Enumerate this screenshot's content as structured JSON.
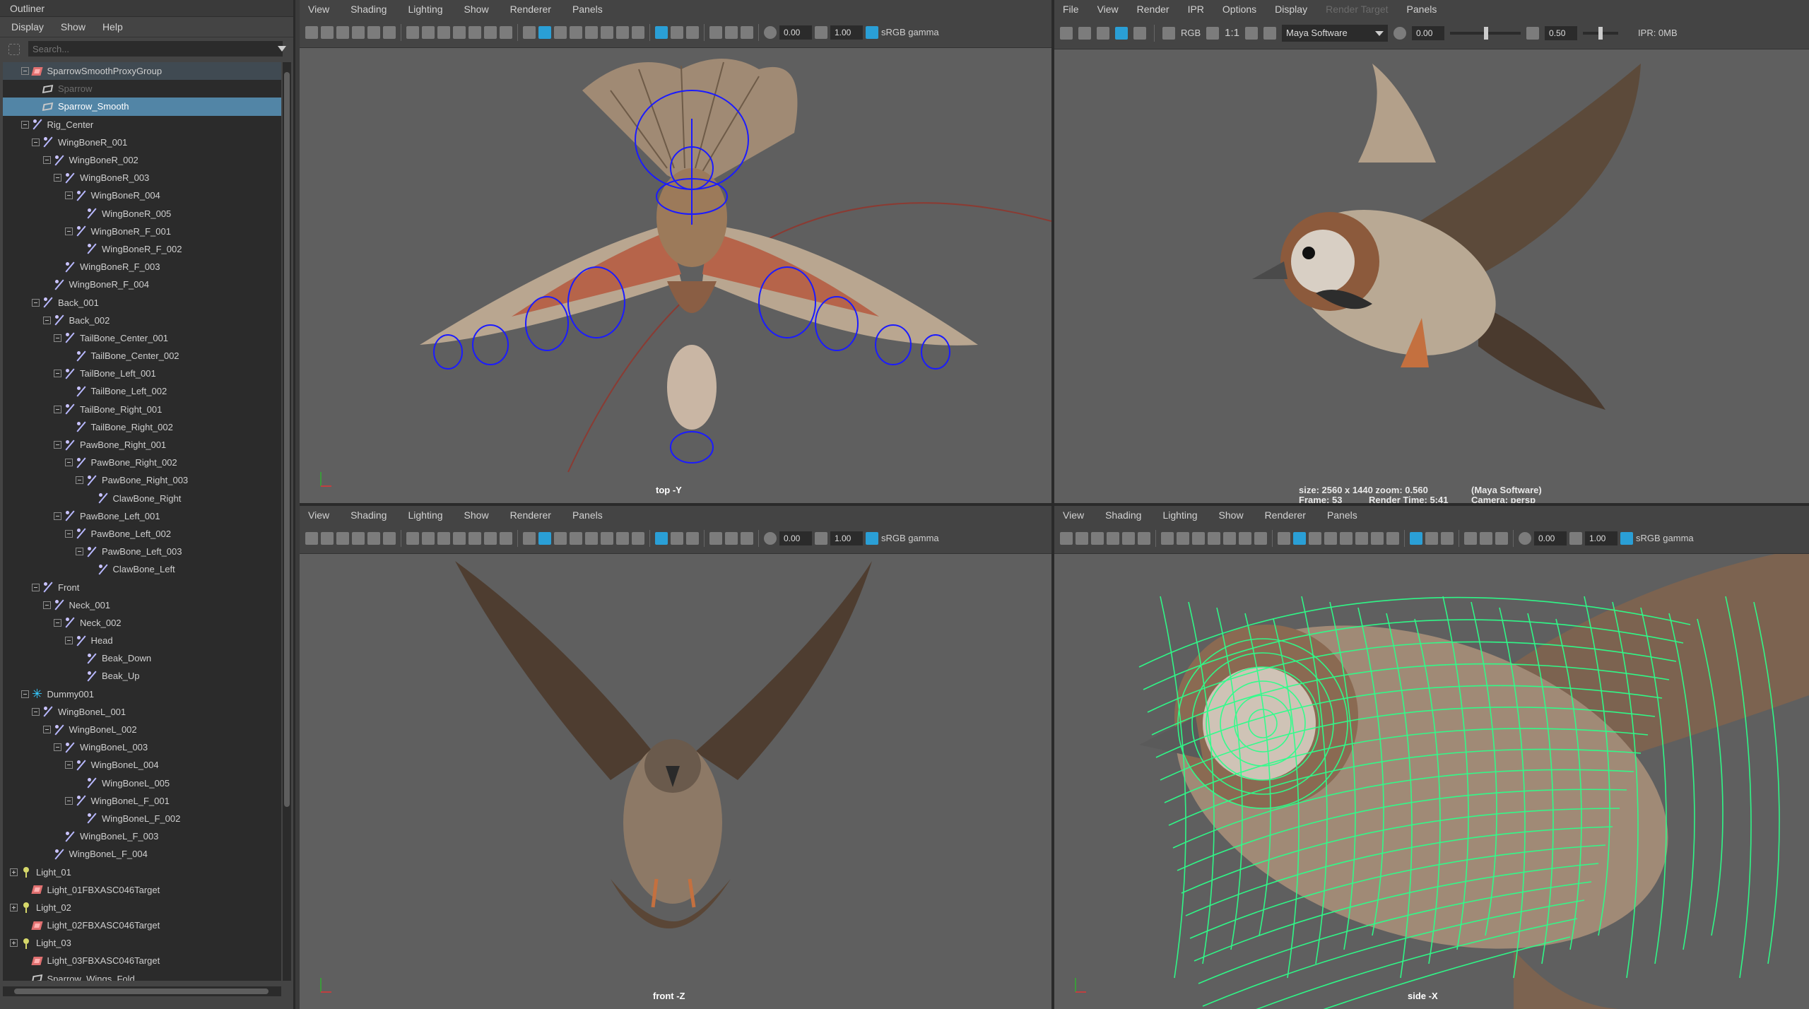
{
  "outliner": {
    "title": "Outliner",
    "menu": [
      "Display",
      "Show",
      "Help"
    ],
    "search_placeholder": "Search...",
    "items": [
      {
        "label": "SparrowSmoothProxyGroup",
        "depth": 1,
        "icon": "group",
        "exp": "minus",
        "state": "grp"
      },
      {
        "label": "Sparrow",
        "depth": 2,
        "icon": "mesh",
        "exp": "none",
        "state": "dim"
      },
      {
        "label": "Sparrow_Smooth",
        "depth": 2,
        "icon": "mesh",
        "exp": "none",
        "state": "sel"
      },
      {
        "label": "Rig_Center",
        "depth": 1,
        "icon": "joint",
        "exp": "minus"
      },
      {
        "label": "WingBoneR_001",
        "depth": 2,
        "icon": "joint",
        "exp": "minus"
      },
      {
        "label": "WingBoneR_002",
        "depth": 3,
        "icon": "joint",
        "exp": "minus"
      },
      {
        "label": "WingBoneR_003",
        "depth": 4,
        "icon": "joint",
        "exp": "minus"
      },
      {
        "label": "WingBoneR_004",
        "depth": 5,
        "icon": "joint",
        "exp": "minus"
      },
      {
        "label": "WingBoneR_005",
        "depth": 6,
        "icon": "joint",
        "exp": "none"
      },
      {
        "label": "WingBoneR_F_001",
        "depth": 5,
        "icon": "joint",
        "exp": "minus"
      },
      {
        "label": "WingBoneR_F_002",
        "depth": 6,
        "icon": "joint",
        "exp": "none"
      },
      {
        "label": "WingBoneR_F_003",
        "depth": 4,
        "icon": "joint",
        "exp": "none"
      },
      {
        "label": "WingBoneR_F_004",
        "depth": 3,
        "icon": "joint",
        "exp": "none"
      },
      {
        "label": "Back_001",
        "depth": 2,
        "icon": "joint",
        "exp": "minus"
      },
      {
        "label": "Back_002",
        "depth": 3,
        "icon": "joint",
        "exp": "minus"
      },
      {
        "label": "TailBone_Center_001",
        "depth": 4,
        "icon": "joint",
        "exp": "minus"
      },
      {
        "label": "TailBone_Center_002",
        "depth": 5,
        "icon": "joint",
        "exp": "none"
      },
      {
        "label": "TailBone_Left_001",
        "depth": 4,
        "icon": "joint",
        "exp": "minus"
      },
      {
        "label": "TailBone_Left_002",
        "depth": 5,
        "icon": "joint",
        "exp": "none"
      },
      {
        "label": "TailBone_Right_001",
        "depth": 4,
        "icon": "joint",
        "exp": "minus"
      },
      {
        "label": "TailBone_Right_002",
        "depth": 5,
        "icon": "joint",
        "exp": "none"
      },
      {
        "label": "PawBone_Right_001",
        "depth": 4,
        "icon": "joint",
        "exp": "minus"
      },
      {
        "label": "PawBone_Right_002",
        "depth": 5,
        "icon": "joint",
        "exp": "minus"
      },
      {
        "label": "PawBone_Right_003",
        "depth": 6,
        "icon": "joint",
        "exp": "minus"
      },
      {
        "label": "ClawBone_Right",
        "depth": 7,
        "icon": "joint",
        "exp": "none"
      },
      {
        "label": "PawBone_Left_001",
        "depth": 4,
        "icon": "joint",
        "exp": "minus"
      },
      {
        "label": "PawBone_Left_002",
        "depth": 5,
        "icon": "joint",
        "exp": "minus"
      },
      {
        "label": "PawBone_Left_003",
        "depth": 6,
        "icon": "joint",
        "exp": "minus"
      },
      {
        "label": "ClawBone_Left",
        "depth": 7,
        "icon": "joint",
        "exp": "none"
      },
      {
        "label": "Front",
        "depth": 2,
        "icon": "joint",
        "exp": "minus"
      },
      {
        "label": "Neck_001",
        "depth": 3,
        "icon": "joint",
        "exp": "minus"
      },
      {
        "label": "Neck_002",
        "depth": 4,
        "icon": "joint",
        "exp": "minus"
      },
      {
        "label": "Head",
        "depth": 5,
        "icon": "joint",
        "exp": "minus"
      },
      {
        "label": "Beak_Down",
        "depth": 6,
        "icon": "joint",
        "exp": "none"
      },
      {
        "label": "Beak_Up",
        "depth": 6,
        "icon": "joint",
        "exp": "none"
      },
      {
        "label": "Dummy001",
        "depth": 1,
        "icon": "star",
        "exp": "minus"
      },
      {
        "label": "WingBoneL_001",
        "depth": 2,
        "icon": "joint",
        "exp": "minus"
      },
      {
        "label": "WingBoneL_002",
        "depth": 3,
        "icon": "joint",
        "exp": "minus"
      },
      {
        "label": "WingBoneL_003",
        "depth": 4,
        "icon": "joint",
        "exp": "minus"
      },
      {
        "label": "WingBoneL_004",
        "depth": 5,
        "icon": "joint",
        "exp": "minus"
      },
      {
        "label": "WingBoneL_005",
        "depth": 6,
        "icon": "joint",
        "exp": "none"
      },
      {
        "label": "WingBoneL_F_001",
        "depth": 5,
        "icon": "joint",
        "exp": "minus"
      },
      {
        "label": "WingBoneL_F_002",
        "depth": 6,
        "icon": "joint",
        "exp": "none"
      },
      {
        "label": "WingBoneL_F_003",
        "depth": 4,
        "icon": "joint",
        "exp": "none"
      },
      {
        "label": "WingBoneL_F_004",
        "depth": 3,
        "icon": "joint",
        "exp": "none"
      },
      {
        "label": "Light_01",
        "depth": 0,
        "icon": "light",
        "exp": "plus"
      },
      {
        "label": "Light_01FBXASC046Target",
        "depth": 1,
        "icon": "group",
        "exp": "none"
      },
      {
        "label": "Light_02",
        "depth": 0,
        "icon": "light",
        "exp": "plus"
      },
      {
        "label": "Light_02FBXASC046Target",
        "depth": 1,
        "icon": "group",
        "exp": "none"
      },
      {
        "label": "Light_03",
        "depth": 0,
        "icon": "light",
        "exp": "plus"
      },
      {
        "label": "Light_03FBXASC046Target",
        "depth": 1,
        "icon": "group",
        "exp": "none"
      },
      {
        "label": "Sparrow_Wings_Fold",
        "depth": 1,
        "icon": "mesh",
        "exp": "none"
      }
    ]
  },
  "viewport_menu": {
    "view": "View",
    "shading": "Shading",
    "lighting": "Lighting",
    "show": "Show",
    "renderer": "Renderer",
    "panels": "Panels"
  },
  "viewport_toolbar": {
    "field1": "0.00",
    "field2": "1.00",
    "colorspace": "sRGB gamma"
  },
  "viewports": {
    "top": {
      "label": "top -Y"
    },
    "front": {
      "label": "front -Z"
    },
    "side": {
      "label": "side -X"
    }
  },
  "render_view": {
    "menu": {
      "file": "File",
      "view": "View",
      "render": "Render",
      "ipr": "IPR",
      "options": "Options",
      "display": "Display",
      "render_target": "Render Target",
      "panels": "Panels"
    },
    "rgb_label": "RGB",
    "ratio_label": "1:1",
    "renderer_select": "Maya Software",
    "exposure_value": "0.00",
    "gamma_value": "0.50",
    "ipr_memory": "IPR: 0MB",
    "info_line1_left": "size: 2560 x 1440 zoom: 0.560",
    "info_line1_right": "(Maya Software)",
    "info_line2_left": "Frame: 53",
    "info_line2_mid": "Render Time: 5:41",
    "info_line2_right": "Camera: persp"
  },
  "colors": {
    "selection": "#5285a6",
    "viewport_bg": "#5f5f5f",
    "rig_controls": "#2020ff",
    "wireframe": "#2dff8a"
  }
}
